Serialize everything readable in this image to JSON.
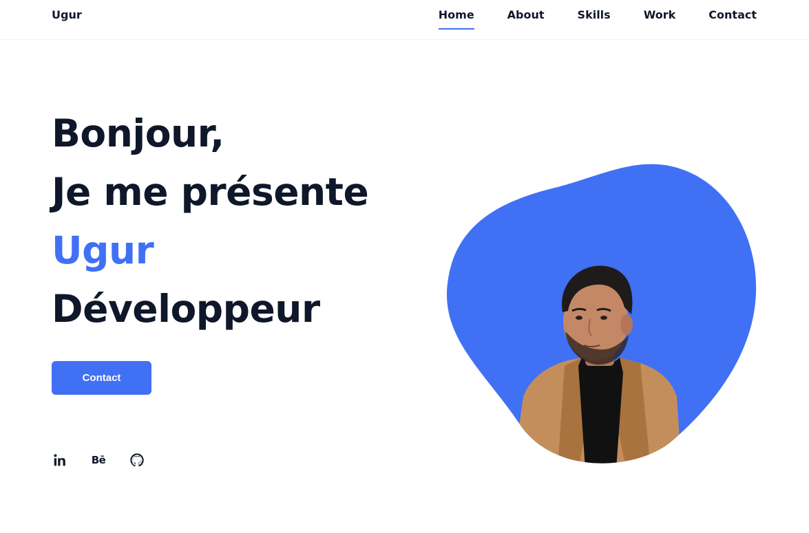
{
  "header": {
    "brand": "Ugur",
    "nav": [
      {
        "label": "Home",
        "active": true
      },
      {
        "label": "About",
        "active": false
      },
      {
        "label": "Skills",
        "active": false
      },
      {
        "label": "Work",
        "active": false
      },
      {
        "label": "Contact",
        "active": false
      }
    ]
  },
  "hero": {
    "line1": "Bonjour,",
    "line2": "Je me présente",
    "line3": "Ugur",
    "line4": "Développeur",
    "button_label": "Contact"
  },
  "socials": [
    {
      "icon": "linkedin-icon",
      "glyph": "in"
    },
    {
      "icon": "behance-icon",
      "glyph": "Bē"
    },
    {
      "icon": "github-icon",
      "glyph": ""
    }
  ],
  "colors": {
    "accent": "#4070f4",
    "text": "#0f172a",
    "background": "#ffffff"
  }
}
